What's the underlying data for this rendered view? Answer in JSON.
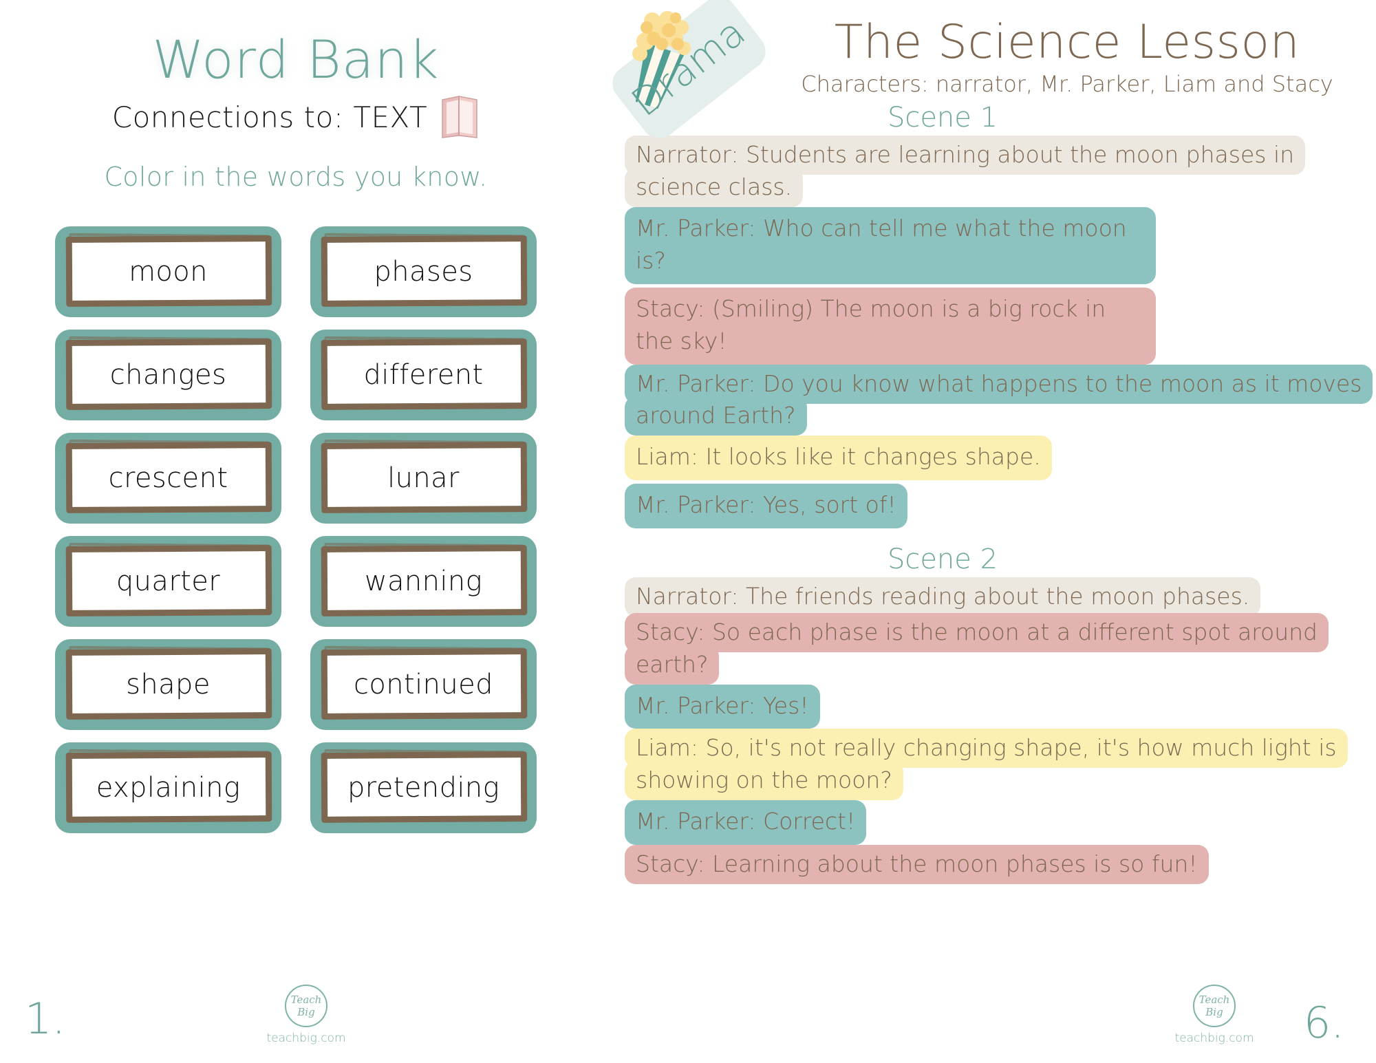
{
  "left_page": {
    "title": "Word Bank",
    "subtitle": "Connections to:  TEXT",
    "book_icon": "book-icon",
    "instruction": "Color in the words you know.",
    "words": [
      "moon",
      "phases",
      "changes",
      "different",
      "crescent",
      "lunar",
      "quarter",
      "wanning",
      "shape",
      "continued",
      "explaining",
      "pretending"
    ],
    "page_number": "1."
  },
  "right_page": {
    "genre_badge": "Drama",
    "popcorn_icon": "popcorn-icon",
    "title": "The Science Lesson",
    "characters": "Characters: narrator, Mr. Parker, Liam and Stacy",
    "scenes": [
      {
        "label": "Scene 1",
        "lines": [
          {
            "speaker": "Narrator",
            "color_key": "c-narrator",
            "text": "Narrator: Students are learning about the moon phases in science class."
          },
          {
            "speaker": "Mr. Parker",
            "color_key": "c-parker",
            "text": "Mr. Parker: Who can tell me what the moon is?"
          },
          {
            "speaker": "Stacy",
            "color_key": "c-stacy",
            "text": "Stacy: (Smiling) The moon is a big rock in the sky!"
          },
          {
            "speaker": "Mr. Parker",
            "color_key": "c-parker",
            "text": "Mr. Parker: Do you know what happens to the moon as it moves around Earth?"
          },
          {
            "speaker": "Liam",
            "color_key": "c-liam",
            "text": "Liam: It looks like it changes shape."
          },
          {
            "speaker": "Mr. Parker",
            "color_key": "c-parker",
            "text": "Mr. Parker: Yes, sort of!"
          }
        ]
      },
      {
        "label": "Scene 2",
        "lines": [
          {
            "speaker": "Narrator",
            "color_key": "c-narrator",
            "text": "Narrator: The friends reading about the moon phases."
          },
          {
            "speaker": "Stacy",
            "color_key": "c-stacy",
            "text": "Stacy: So each phase is the moon at a different spot around earth?"
          },
          {
            "speaker": "Mr. Parker",
            "color_key": "c-parker",
            "text": "Mr. Parker: Yes!"
          },
          {
            "speaker": "Liam",
            "color_key": "c-liam",
            "text": "Liam: So, it's not really changing shape, it's how much light is showing on the moon?"
          },
          {
            "speaker": "Mr. Parker",
            "color_key": "c-parker",
            "text": "Mr. Parker: Correct!"
          },
          {
            "speaker": "Stacy",
            "color_key": "c-stacy",
            "text": "Stacy: Learning about the moon phases is so fun!"
          }
        ]
      }
    ],
    "page_number": "6."
  },
  "branding": {
    "logo_mark": "Teach Big",
    "logo_url_text": "teachbig.com"
  },
  "colors": {
    "teal": "#6fa79c",
    "teal_box": "#74ada3",
    "brown": "#7d6751",
    "narrator_bg": "#ece7df",
    "parker_bg": "#8cc2c0",
    "stacy_bg": "#e2b3b0",
    "liam_bg": "#fbf0b2",
    "banner_bg": "#e4eeec"
  }
}
